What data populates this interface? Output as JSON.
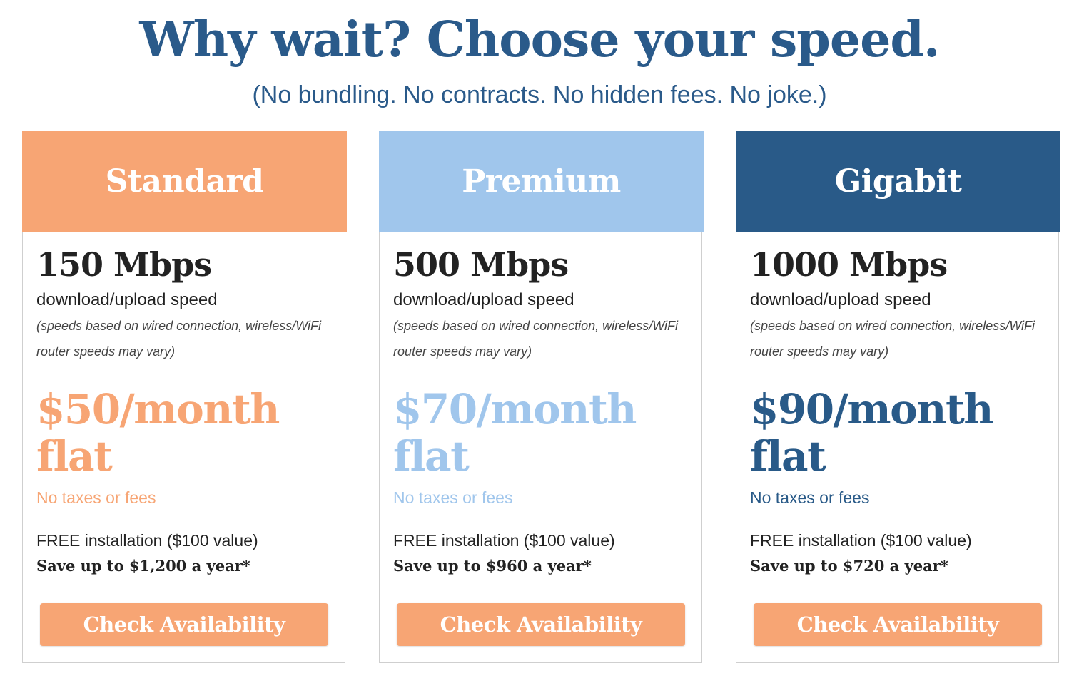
{
  "colors": {
    "heading": "#2a5a8a",
    "standard": "#f7a574",
    "premium": "#a0c6ec",
    "gigabit": "#295a88",
    "cta": "#f7a574"
  },
  "header": {
    "title": "Why wait? Choose your speed.",
    "subtitle": "(No bundling. No contracts. No hidden fees. No joke.)"
  },
  "plans": [
    {
      "name": "Standard",
      "speed": "150 Mbps",
      "speed_desc": "download/upload speed",
      "speed_note": "(speeds based on wired connection, wireless/WiFi router speeds may vary)",
      "price": "$50/month flat",
      "fees": "No taxes or fees",
      "install": "FREE installation ($100 value)",
      "savings": "Save up to $1,200 a year*",
      "cta_label": "Check Availability",
      "color": "#f7a574"
    },
    {
      "name": "Premium",
      "speed": "500 Mbps",
      "speed_desc": "download/upload speed",
      "speed_note": "(speeds based on wired connection, wireless/WiFi router speeds may vary)",
      "price": "$70/month flat",
      "fees": "No taxes or fees",
      "install": "FREE installation ($100 value)",
      "savings": "Save up to $960 a year*",
      "cta_label": "Check Availability",
      "color": "#a0c6ec"
    },
    {
      "name": "Gigabit",
      "speed": "1000 Mbps",
      "speed_desc": "download/upload speed",
      "speed_note": "(speeds based on wired connection, wireless/WiFi router speeds may vary)",
      "price": "$90/month flat",
      "fees": "No taxes or fees",
      "install": "FREE installation ($100 value)",
      "savings": "Save up to $720 a year*",
      "cta_label": "Check Availability",
      "color": "#295a88"
    }
  ]
}
